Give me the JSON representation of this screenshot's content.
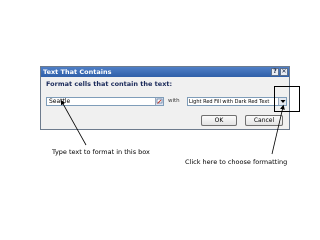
{
  "dialog": {
    "title": "Text That Contains",
    "help_label": "?",
    "close_label": "✕",
    "instruction": "Format cells that contain the text:",
    "input_value": "Seattle",
    "with_label": "with",
    "format_value": "Light Red Fill with Dark Red Text",
    "ok_label": "OK",
    "cancel_label": "Cancel"
  },
  "annotations": {
    "left": "Type text to format in this box",
    "right": "Click here to choose formatting"
  },
  "icons": {
    "collapse_dialog": "range-select-icon",
    "dropdown": "chevron-down-icon"
  },
  "colors": {
    "titlebar": "#2f5fa8",
    "instruction_text": "#1a2a5a"
  }
}
